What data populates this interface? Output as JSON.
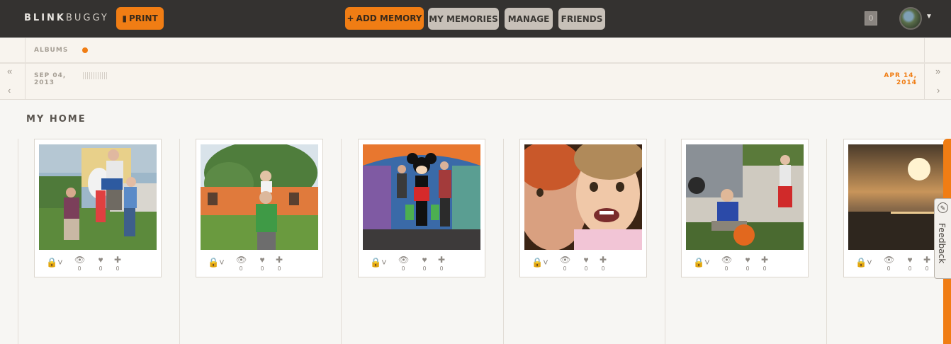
{
  "header": {
    "logo_bold": "BLINK",
    "logo_light": "BUGGY",
    "print_label": "PRINT",
    "add_memory_label": "ADD MEMORY",
    "my_memories_label": "MY MEMORIES",
    "manage_label": "MANAGE",
    "friends_label": "FRIENDS",
    "notification_count": "0"
  },
  "timeline": {
    "albums_label": "ALBUMS",
    "start_date_line1": "SEP 04,",
    "start_date_line2": "2013",
    "end_date_line1": "APR 14,",
    "end_date_line2": "2014"
  },
  "main": {
    "section_title": "MY HOME",
    "cards": [
      {
        "views": "0",
        "likes": "0",
        "adds": "0"
      },
      {
        "views": "0",
        "likes": "0",
        "adds": "0"
      },
      {
        "views": "0",
        "likes": "0",
        "adds": "0"
      },
      {
        "views": "0",
        "likes": "0",
        "adds": "0"
      },
      {
        "views": "0",
        "likes": "0",
        "adds": "0"
      },
      {
        "views": "0",
        "likes": "0",
        "adds": "0"
      }
    ]
  },
  "feedback": {
    "label": "Feedback"
  },
  "colors": {
    "accent": "#f07d14",
    "topbar": "#343230",
    "nav_button": "#c7c0b8"
  },
  "icons": [
    "book-icon",
    "plus-icon",
    "avatar",
    "lock-icon",
    "eye-icon",
    "heart-icon",
    "plus-icon",
    "feedback-icon"
  ]
}
